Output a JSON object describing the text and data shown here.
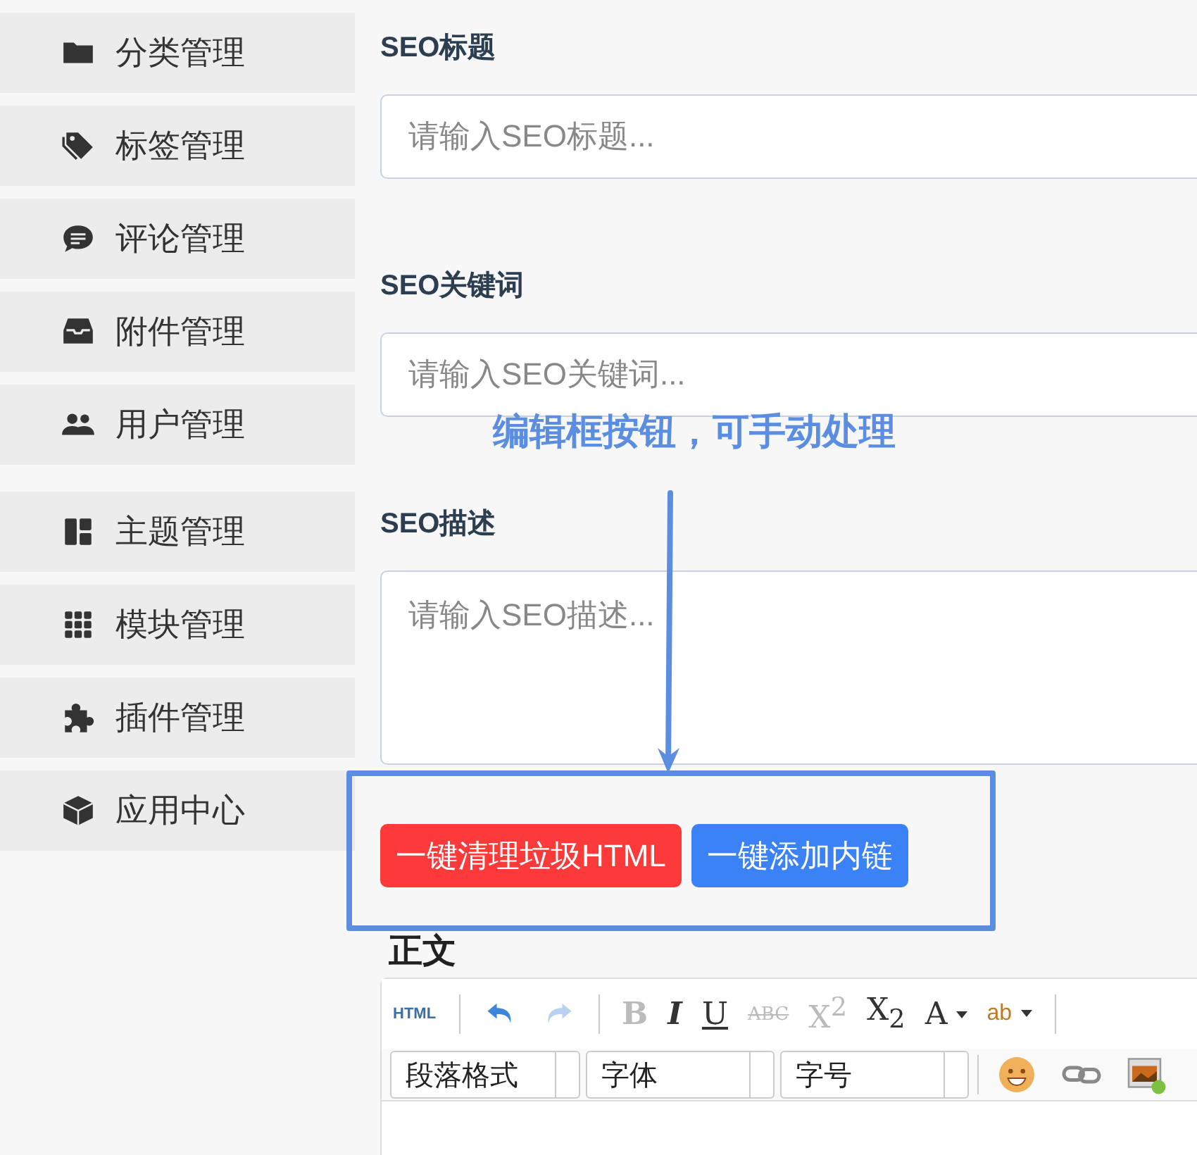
{
  "sidebar": {
    "groups": [
      {
        "items": [
          {
            "kind": "folder",
            "label": "分类管理"
          },
          {
            "kind": "tag",
            "label": "标签管理"
          },
          {
            "kind": "comment",
            "label": "评论管理"
          },
          {
            "kind": "attachment",
            "label": "附件管理"
          },
          {
            "kind": "users",
            "label": "用户管理"
          }
        ]
      },
      {
        "items": [
          {
            "kind": "theme",
            "label": "主题管理"
          },
          {
            "kind": "grid",
            "label": "模块管理"
          },
          {
            "kind": "puzzle",
            "label": "插件管理"
          },
          {
            "kind": "box",
            "label": "应用中心"
          }
        ]
      }
    ]
  },
  "form": {
    "fields": [
      {
        "kind": "input",
        "label": "SEO标题",
        "placeholder": "请输入SEO标题..."
      },
      {
        "kind": "input",
        "label": "SEO关键词",
        "placeholder": "请输入SEO关键词..."
      },
      {
        "kind": "textarea",
        "label": "SEO描述",
        "placeholder": "请输入SEO描述..."
      }
    ],
    "buttons": [
      {
        "kind": "danger",
        "label": "一键清理垃圾HTML"
      },
      {
        "kind": "primary",
        "label": "一键添加内链"
      }
    ],
    "body_label": "正文"
  },
  "editor": {
    "toolbar_row_1": [
      {
        "kind": "text",
        "label": "HTML",
        "disabled": false
      },
      {
        "kind": "separator"
      },
      {
        "kind": "undo",
        "disabled": false
      },
      {
        "kind": "redo",
        "disabled": true
      },
      {
        "kind": "separator"
      },
      {
        "kind": "bold",
        "label": "B",
        "disabled": true
      },
      {
        "kind": "italic",
        "label": "I",
        "disabled": false
      },
      {
        "kind": "underline",
        "label": "U",
        "disabled": false
      },
      {
        "kind": "strike",
        "label": "ABC",
        "disabled": true
      },
      {
        "kind": "super",
        "label": "X$^{2}$",
        "disabled": true
      },
      {
        "kind": "sub",
        "label": "X$_{2}$",
        "disabled": false
      },
      {
        "kind": "dropdown_letter",
        "label": "A",
        "disabled": false
      },
      {
        "kind": "highlight",
        "label": "ab",
        "disabled": false
      },
      {
        "kind": "separator"
      }
    ],
    "toolbar_row_2": [
      {
        "kind": "select",
        "value": "段落格式"
      },
      {
        "kind": "select",
        "value": "字体"
      },
      {
        "kind": "select",
        "value": "字号"
      },
      {
        "kind": "separator"
      },
      {
        "kind": "emoji"
      },
      {
        "kind": "link"
      },
      {
        "kind": "image"
      }
    ]
  },
  "annotation": {
    "text": "编辑框按钮，可手动处理"
  }
}
